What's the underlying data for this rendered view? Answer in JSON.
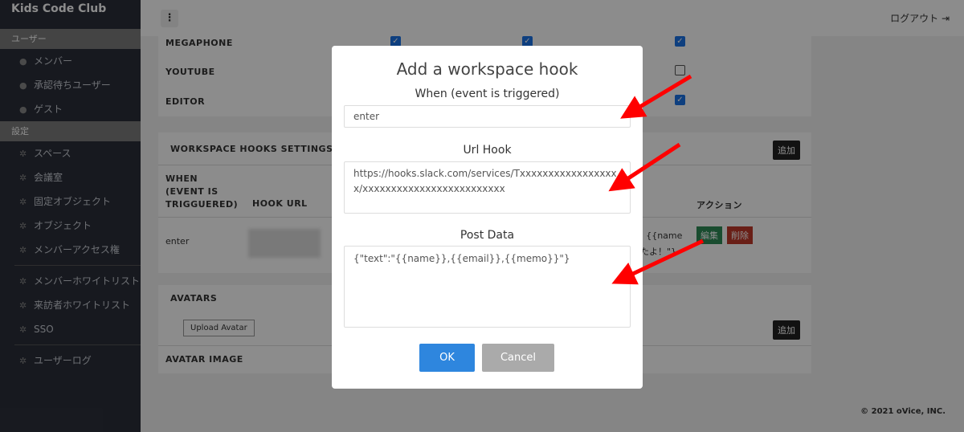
{
  "sidebar": {
    "brand": "Kids Code Club",
    "section_users": "ユーザー",
    "users": [
      {
        "label": "メンバー",
        "icon": "user-icon"
      },
      {
        "label": "承認待ちユーザー",
        "icon": "user-plus-icon"
      },
      {
        "label": "ゲスト",
        "icon": "guest-icon"
      }
    ],
    "section_settings": "設定",
    "settings": [
      {
        "label": "スペース"
      },
      {
        "label": "会議室"
      },
      {
        "label": "固定オブジェクト"
      },
      {
        "label": "オブジェクト"
      },
      {
        "label": "メンバーアクセス権"
      }
    ],
    "lists": [
      {
        "label": "メンバーホワイトリスト"
      },
      {
        "label": "来訪者ホワイトリスト"
      },
      {
        "label": "SSO"
      }
    ],
    "logs": [
      {
        "label": "ユーザーログ"
      }
    ]
  },
  "topbar": {
    "menu": "⋮",
    "logout": "ログアウト"
  },
  "features": {
    "rows": [
      {
        "name": "MEGAPHONE",
        "checks": [
          true,
          true,
          true
        ]
      },
      {
        "name": "YOUTUBE",
        "checks": [
          null,
          null,
          false
        ]
      },
      {
        "name": "EDITOR",
        "checks": [
          null,
          null,
          true
        ]
      }
    ]
  },
  "hooks": {
    "title": "WORKSPACE HOOKS SETTINGS",
    "add": "追加",
    "col_when": "WHEN (EVENT IS TRIGGUERED)",
    "col_url": "HOOK URL",
    "col_action": "アクション",
    "row": {
      "when": "enter",
      "post_fragment": ": {{name",
      "post_fragment2": "たよ！\"}",
      "edit": "編集",
      "delete": "削除"
    }
  },
  "avatars": {
    "title": "AVATARS",
    "upload": "Upload Avatar",
    "add": "追加",
    "col_image": "AVATAR IMAGE"
  },
  "footer": "© 2021 oVice, INC.",
  "modal": {
    "title": "Add a workspace hook",
    "when_label": "When (event is triggered)",
    "when_value": "enter",
    "url_label": "Url Hook",
    "url_value": "https://hooks.slack.com/services/Txxxxxxxxxxxxxxxxxx/xxxxxxxxxxxxxxxxxxxxxxxxx",
    "post_label": "Post Data",
    "post_value": "{\"text\":\"{{name}},{{email}},{{memo}}\"}",
    "ok": "OK",
    "cancel": "Cancel"
  },
  "colors": {
    "primary": "#2e86de",
    "arrow": "#ff0000",
    "edit": "#2e8b57",
    "delete": "#c0392b"
  }
}
